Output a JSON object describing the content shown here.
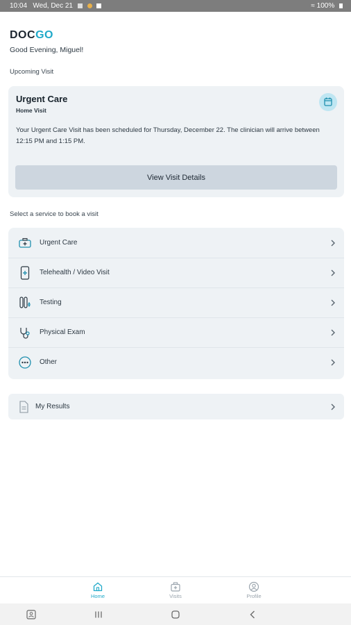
{
  "status_bar": {
    "time": "10:04",
    "date": "Wed, Dec 21",
    "battery": "100%"
  },
  "header": {
    "logo_part1": "DOC",
    "logo_part2": "GO",
    "greeting": "Good Evening, Miguel!"
  },
  "upcoming": {
    "section_title": "Upcoming Visit",
    "title": "Urgent Care",
    "subtitle": "Home Visit",
    "description": "Your Urgent Care Visit has been scheduled for Thursday, December 22. The clinician will arrive between 12:15 PM and 1:15 PM.",
    "button_label": "View Visit Details",
    "icon": "calendar-icon"
  },
  "services": {
    "section_title": "Select a service to book a visit",
    "items": [
      {
        "label": "Urgent Care",
        "icon": "first-aid-kit-icon"
      },
      {
        "label": "Telehealth / Video Visit",
        "icon": "phone-plus-icon"
      },
      {
        "label": "Testing",
        "icon": "test-tube-icon"
      },
      {
        "label": "Physical Exam",
        "icon": "stethoscope-icon"
      },
      {
        "label": "Other",
        "icon": "more-circle-icon"
      }
    ]
  },
  "results": {
    "label": "My Results",
    "icon": "document-icon"
  },
  "tabs": [
    {
      "label": "Home",
      "icon": "home-icon",
      "active": true
    },
    {
      "label": "Visits",
      "icon": "medical-bag-icon",
      "active": false
    },
    {
      "label": "Profile",
      "icon": "profile-icon",
      "active": false
    }
  ],
  "colors": {
    "accent": "#1fa9c9",
    "card_bg": "#eef2f5",
    "button_bg": "#cdd6df"
  }
}
